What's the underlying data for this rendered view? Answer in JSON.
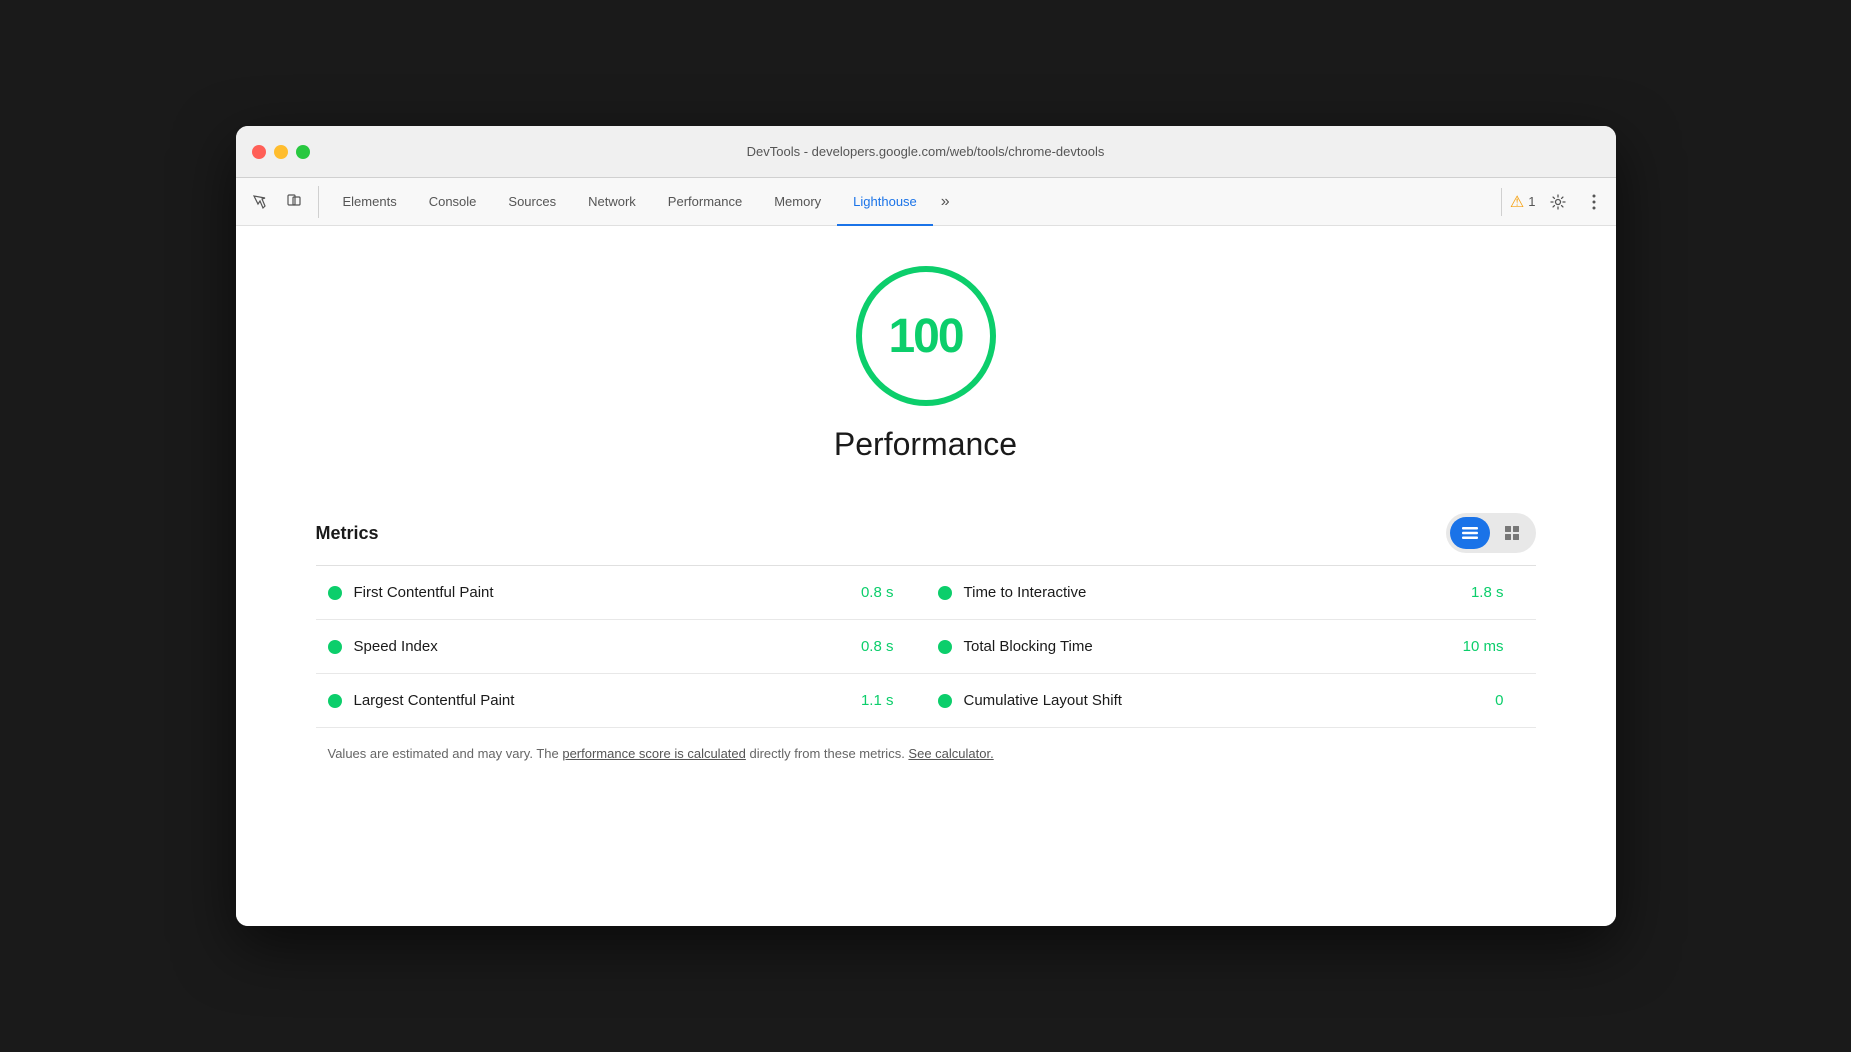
{
  "window": {
    "title": "DevTools - developers.google.com/web/tools/chrome-devtools"
  },
  "toolbar": {
    "tabs": [
      {
        "id": "elements",
        "label": "Elements",
        "active": false
      },
      {
        "id": "console",
        "label": "Console",
        "active": false
      },
      {
        "id": "sources",
        "label": "Sources",
        "active": false
      },
      {
        "id": "network",
        "label": "Network",
        "active": false
      },
      {
        "id": "performance",
        "label": "Performance",
        "active": false
      },
      {
        "id": "memory",
        "label": "Memory",
        "active": false
      },
      {
        "id": "lighthouse",
        "label": "Lighthouse",
        "active": true
      }
    ],
    "warning_count": "1",
    "more_tabs_label": "»"
  },
  "lighthouse": {
    "score": "100",
    "score_label": "Performance",
    "metrics_title": "Metrics",
    "metrics": [
      {
        "name": "First Contentful Paint",
        "value": "0.8 s",
        "dot_color": "#0cce6b"
      },
      {
        "name": "Speed Index",
        "value": "0.8 s",
        "dot_color": "#0cce6b"
      },
      {
        "name": "Largest Contentful Paint",
        "value": "1.1 s",
        "dot_color": "#0cce6b"
      },
      {
        "name": "Time to Interactive",
        "value": "1.8 s",
        "dot_color": "#0cce6b"
      },
      {
        "name": "Total Blocking Time",
        "value": "10 ms",
        "dot_color": "#0cce6b"
      },
      {
        "name": "Cumulative Layout Shift",
        "value": "0",
        "dot_color": "#0cce6b"
      }
    ],
    "footer_text_1": "Values are estimated and may vary. The ",
    "footer_link_1": "performance score is calculated",
    "footer_text_2": " directly from these metrics. ",
    "footer_link_2": "See calculator.",
    "view_toggle": {
      "list_label": "≡",
      "grid_label": "☰"
    }
  }
}
